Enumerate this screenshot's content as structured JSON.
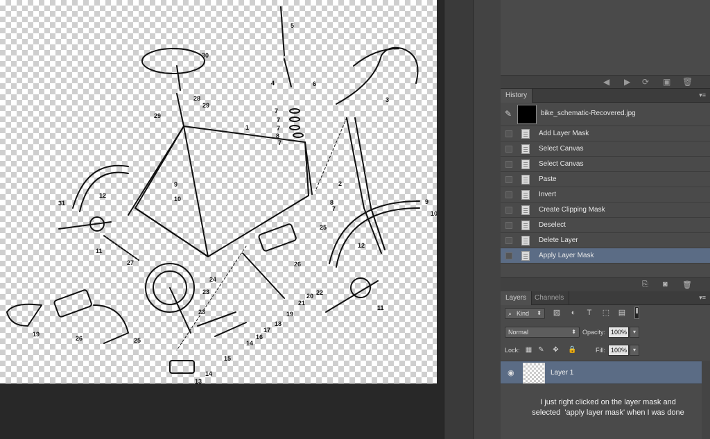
{
  "canvas": {
    "part_numbers": [
      "1",
      "2",
      "3",
      "4",
      "5",
      "6",
      "7",
      "7",
      "7",
      "7",
      "7",
      "8",
      "8",
      "9",
      "9",
      "10",
      "10",
      "11",
      "11",
      "12",
      "12",
      "13",
      "14",
      "14",
      "15",
      "16",
      "17",
      "18",
      "19",
      "19",
      "20",
      "21",
      "22",
      "23",
      "23",
      "24",
      "25",
      "25",
      "26",
      "26",
      "27",
      "28",
      "29",
      "29",
      "30",
      "31"
    ]
  },
  "history": {
    "tab_label": "History",
    "snapshot_label": "bike_schematic-Recovered.jpg",
    "steps": [
      {
        "label": "Add Layer Mask",
        "selected": false
      },
      {
        "label": "Select Canvas",
        "selected": false
      },
      {
        "label": "Select Canvas",
        "selected": false
      },
      {
        "label": "Paste",
        "selected": false
      },
      {
        "label": "Invert",
        "selected": false
      },
      {
        "label": "Create Clipping Mask",
        "selected": false
      },
      {
        "label": "Deselect",
        "selected": false
      },
      {
        "label": "Delete Layer",
        "selected": false
      },
      {
        "label": "Apply Layer Mask",
        "selected": true
      }
    ]
  },
  "layers": {
    "tab_layers": "Layers",
    "tab_channels": "Channels",
    "filter_kind": "Kind",
    "blend_mode": "Normal",
    "opacity_label": "Opacity:",
    "opacity_value": "100%",
    "lock_label": "Lock:",
    "fill_label": "Fill:",
    "fill_value": "100%",
    "layer_name": "Layer 1"
  },
  "annotation": {
    "line1": "I just right clicked on the layer mask and",
    "line2": "selected  'apply layer mask' when I was done"
  },
  "colors": {
    "selection": "#5b6c85",
    "panel": "#4a4a4a",
    "background": "#282828"
  }
}
